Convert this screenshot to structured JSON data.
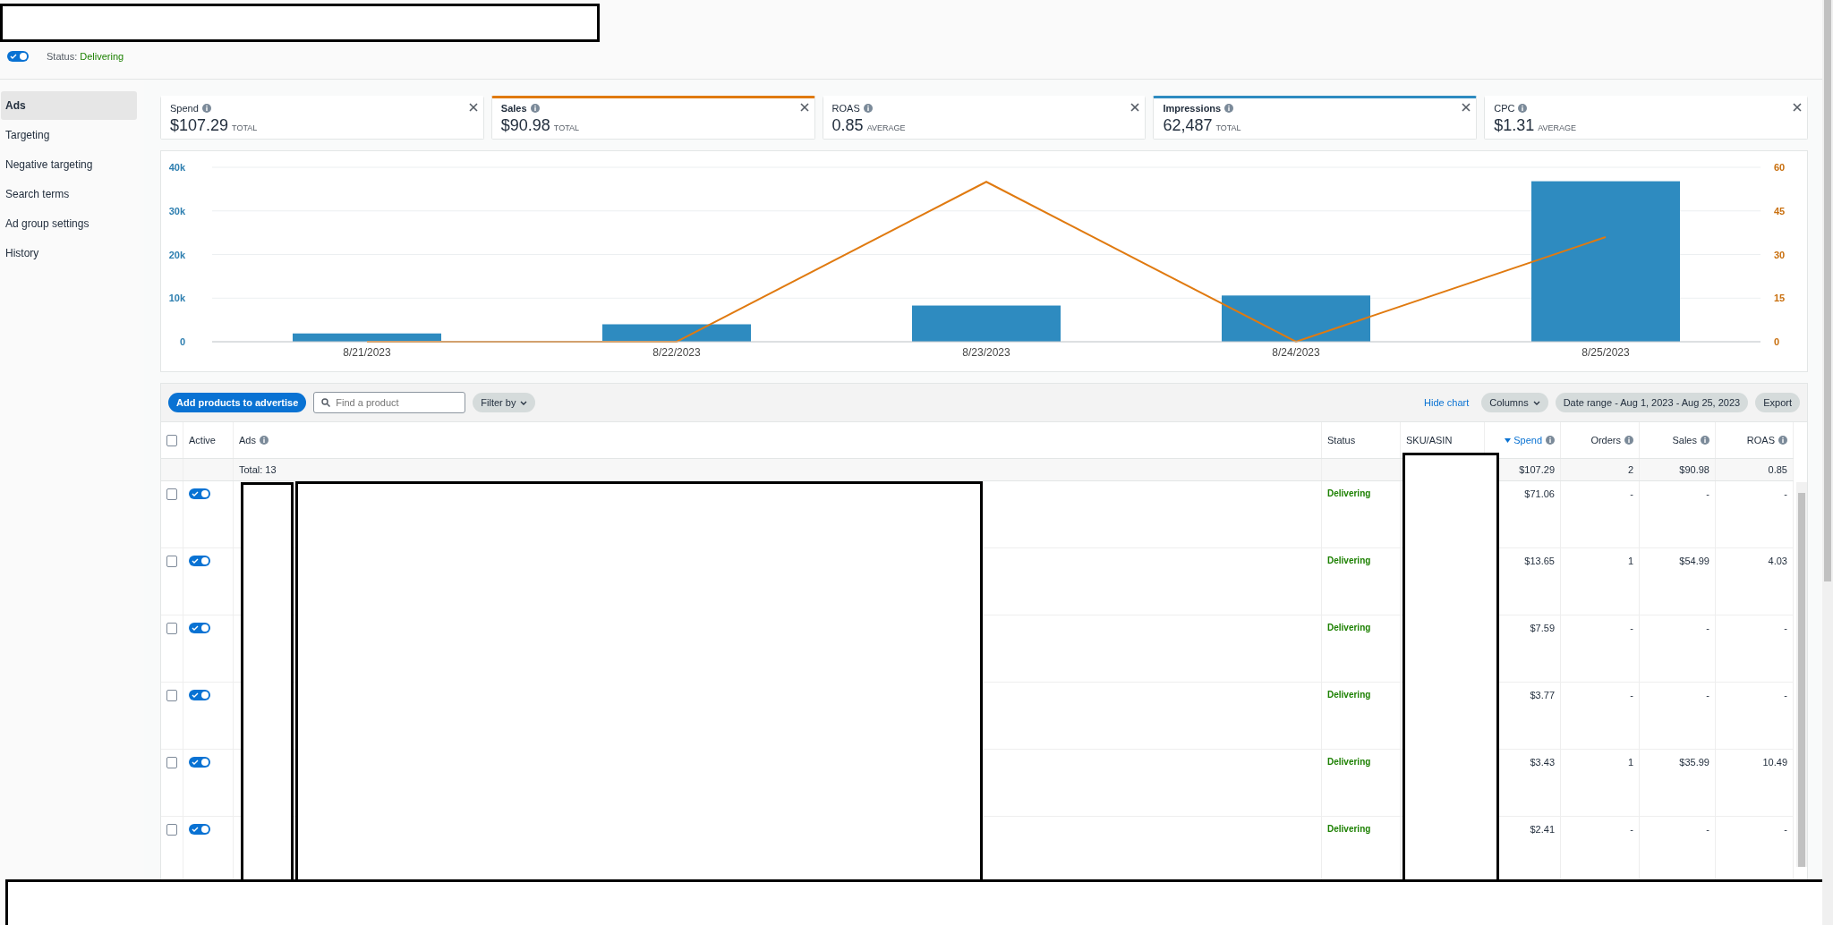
{
  "header": {
    "active": true,
    "status_label": "Status:",
    "status": "Delivering"
  },
  "sidebar": {
    "items": [
      {
        "label": "Ads",
        "selected": true
      },
      {
        "label": "Targeting",
        "selected": false
      },
      {
        "label": "Negative targeting",
        "selected": false
      },
      {
        "label": "Search terms",
        "selected": false
      },
      {
        "label": "Ad group settings",
        "selected": false
      },
      {
        "label": "History",
        "selected": false
      }
    ]
  },
  "metrics": [
    {
      "label": "Spend",
      "value": "$107.29",
      "unit": "TOTAL",
      "selected": false
    },
    {
      "label": "Sales",
      "value": "$90.98",
      "unit": "TOTAL",
      "selected": true,
      "color": "#e07a10"
    },
    {
      "label": "ROAS",
      "value": "0.85",
      "unit": "AVERAGE",
      "selected": false
    },
    {
      "label": "Impressions",
      "value": "62,487",
      "unit": "TOTAL",
      "selected": true,
      "color": "#2e8bc0"
    },
    {
      "label": "CPC",
      "value": "$1.31",
      "unit": "AVERAGE",
      "selected": false
    }
  ],
  "chart": {
    "chart_data": {
      "type": "bar",
      "categories": [
        "8/21/2023",
        "8/22/2023",
        "8/23/2023",
        "8/24/2023",
        "8/25/2023"
      ],
      "series": [
        {
          "color": "#2e8bc0",
          "values": [
            1900,
            4000,
            8300,
            10600,
            36800
          ]
        },
        {
          "type": "line",
          "axis": "y2",
          "color": "#e07a10",
          "values": [
            0,
            0,
            55,
            0,
            36
          ]
        }
      ],
      "grid": true,
      "ylim": [
        0,
        40000
      ],
      "yticks": [
        {
          "value": 0,
          "label": "0"
        },
        {
          "value": 10000,
          "label": "10k"
        },
        {
          "value": 20000,
          "label": "20k"
        },
        {
          "value": 30000,
          "label": "30k"
        },
        {
          "value": 40000,
          "label": "40k"
        }
      ],
      "y2lim": [
        0,
        60
      ],
      "y2ticks": [
        {
          "value": 0,
          "label": "0"
        },
        {
          "value": 15,
          "label": "15"
        },
        {
          "value": 30,
          "label": "30"
        },
        {
          "value": 45,
          "label": "45"
        },
        {
          "value": 60,
          "label": "60"
        }
      ]
    }
  },
  "toolbar": {
    "add_button": "Add products to advertise",
    "search": {
      "placeholder": "Find a product"
    },
    "filter": "Filter by",
    "hide_chart": "Hide chart",
    "columns": "Columns",
    "date_range": "Date range - Aug 1, 2023 - Aug 25, 2023",
    "export": "Export"
  },
  "table": {
    "select_all_checked": false,
    "columns": [
      {
        "label": "Active",
        "info": false,
        "sorted": false
      },
      {
        "label": "Ads",
        "info": true,
        "sorted": false
      },
      {
        "label": "Status",
        "info": false,
        "sorted": false
      },
      {
        "label": "SKU/ASIN",
        "info": false,
        "sorted": false
      },
      {
        "label": "Spend",
        "info": true,
        "sorted": true
      },
      {
        "label": "Orders",
        "info": true,
        "sorted": false
      },
      {
        "label": "Sales",
        "info": true,
        "sorted": false
      },
      {
        "label": "ROAS",
        "info": true,
        "sorted": false
      }
    ],
    "total": {
      "label": "Total: 13",
      "spend": "$107.29",
      "orders": "2",
      "sales": "$90.98",
      "roas": "0.85"
    },
    "rows": [
      {
        "checked": false,
        "active": true,
        "status": "Delivering",
        "spend": "$71.06",
        "orders": "-",
        "sales": "-",
        "roas": "-"
      },
      {
        "checked": false,
        "active": true,
        "status": "Delivering",
        "spend": "$13.65",
        "orders": "1",
        "sales": "$54.99",
        "roas": "4.03"
      },
      {
        "checked": false,
        "active": true,
        "status": "Delivering",
        "spend": "$7.59",
        "orders": "-",
        "sales": "-",
        "roas": "-"
      },
      {
        "checked": false,
        "active": true,
        "status": "Delivering",
        "spend": "$3.77",
        "orders": "-",
        "sales": "-",
        "roas": "-"
      },
      {
        "checked": false,
        "active": true,
        "status": "Delivering",
        "spend": "$3.43",
        "orders": "1",
        "sales": "$35.99",
        "roas": "10.49"
      },
      {
        "checked": false,
        "active": true,
        "status": "Delivering",
        "spend": "$2.41",
        "orders": "-",
        "sales": "-",
        "roas": "-"
      }
    ]
  }
}
